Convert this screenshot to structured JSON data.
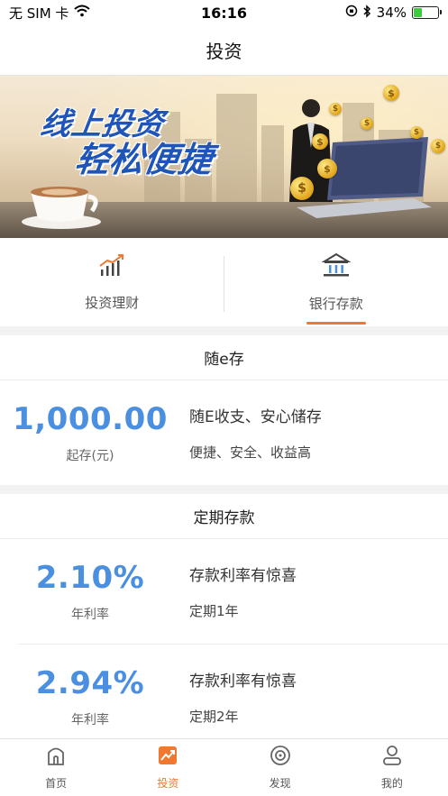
{
  "status_bar": {
    "carrier": "无 SIM 卡",
    "time": "16:16",
    "battery_percent": "34%",
    "battery_level": 0.34,
    "icons": [
      "wifi-icon",
      "orientation-lock-icon",
      "bluetooth-icon",
      "battery-icon"
    ]
  },
  "nav": {
    "title": "投资"
  },
  "banner": {
    "slogan_line1": "线上投资",
    "slogan_line2": "轻松便捷"
  },
  "tabs": [
    {
      "label": "投资理财",
      "icon": "bar-chart-icon",
      "active": false
    },
    {
      "label": "银行存款",
      "icon": "bank-icon",
      "active": true
    }
  ],
  "sections": {
    "sui_e": {
      "title": "随e存",
      "product": {
        "amount": "1,000.00",
        "amount_label": "起存(元)",
        "line1": "随E收支、安心储存",
        "line2": "便捷、安全、收益高"
      }
    },
    "fixed": {
      "title": "定期存款",
      "products": [
        {
          "rate": "2.10%",
          "rate_label": "年利率",
          "line1": "存款利率有惊喜",
          "line2": "定期1年"
        },
        {
          "rate": "2.94%",
          "rate_label": "年利率",
          "line1": "存款利率有惊喜",
          "line2": "定期2年"
        }
      ]
    }
  },
  "tabbar": [
    {
      "label": "首页",
      "icon": "home-icon",
      "active": false
    },
    {
      "label": "投资",
      "icon": "invest-chart-icon",
      "active": true
    },
    {
      "label": "发现",
      "icon": "discover-icon",
      "active": false
    },
    {
      "label": "我的",
      "icon": "profile-icon",
      "active": false
    }
  ],
  "colors": {
    "accent": "#f0782f",
    "value_blue": "#4a8fe0",
    "slogan_blue": "#1f55b8"
  }
}
